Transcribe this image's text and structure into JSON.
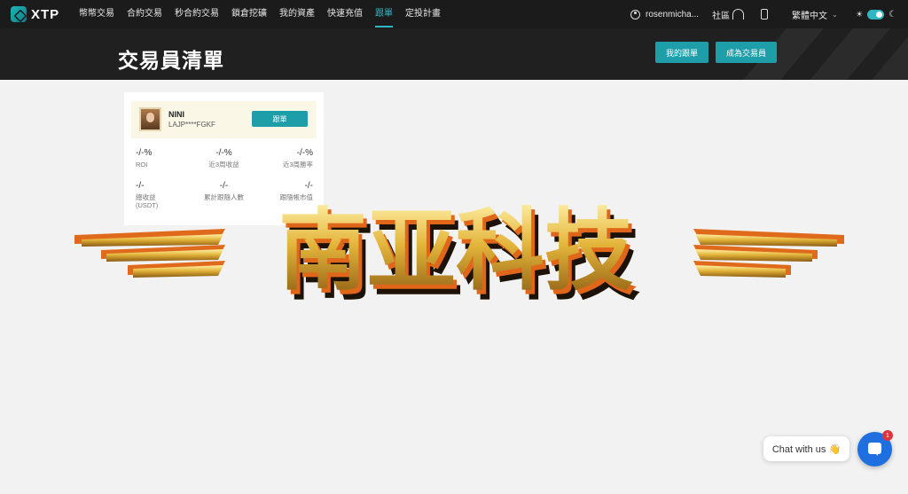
{
  "brand": {
    "name": "XTP"
  },
  "nav": [
    {
      "label": "幣幣交易"
    },
    {
      "label": "合約交易"
    },
    {
      "label": "秒合約交易"
    },
    {
      "label": "鎖倉挖礦"
    },
    {
      "label": "我的資產"
    },
    {
      "label": "快速充值"
    },
    {
      "label": "跟單",
      "active": true
    },
    {
      "label": "定投計畫"
    }
  ],
  "user": {
    "name": "rosenmicha..."
  },
  "community": {
    "label": "社區"
  },
  "language": {
    "label": "繁體中文",
    "icon": "chevron-down-icon"
  },
  "theme": {
    "sun_icon": "☀",
    "moon_icon": "☾"
  },
  "header": {
    "title": "交易員清單",
    "my_follow": "我的跟單",
    "become_trader": "成為交易員"
  },
  "trader": {
    "name": "NINI",
    "uid": "LAJP****FGKF",
    "follow": "跟單",
    "stats": [
      {
        "value": "-/-%",
        "label": "ROI"
      },
      {
        "value": "-/-%",
        "label": "近3周收益"
      },
      {
        "value": "-/-%",
        "label": "近3周勝率"
      },
      {
        "value": "-/-",
        "label": "總收益 (USDT)"
      },
      {
        "value": "-/-",
        "label": "累計跟隨人數"
      },
      {
        "value": "-/-",
        "label": "跟隨帳市值"
      }
    ]
  },
  "overlay": {
    "text": "南亚科技"
  },
  "chat": {
    "label": "Chat with us 👋",
    "badge": "1"
  },
  "colors": {
    "accent": "#1e9ea9",
    "nav_bg": "#1b1b1b",
    "chat_blue": "#1f6fe0"
  }
}
